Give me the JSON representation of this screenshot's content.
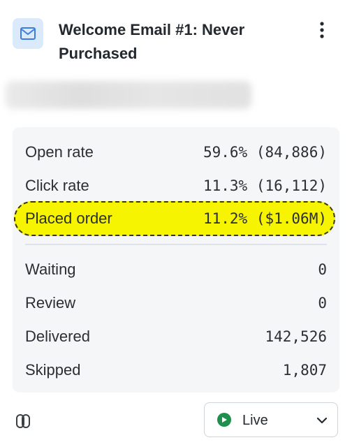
{
  "header": {
    "icon": "mail-icon",
    "title": "Welcome Email #1: Never Purchased",
    "menu_icon": "kebab-menu-icon"
  },
  "stats": {
    "metrics": [
      {
        "label": "Open rate",
        "value": "59.6% (84,886)"
      },
      {
        "label": "Click rate",
        "value": "11.3% (16,112)"
      },
      {
        "label": "Placed order",
        "value": "11.2% ($1.06M)"
      }
    ],
    "counts": [
      {
        "label": "Waiting",
        "value": "0"
      },
      {
        "label": "Review",
        "value": "0"
      },
      {
        "label": "Delivered",
        "value": "142,526"
      },
      {
        "label": "Skipped",
        "value": "1,807"
      }
    ]
  },
  "footer": {
    "link_icon": "link-icon",
    "status": {
      "label": "Live",
      "icon": "play-circle-icon",
      "dropdown_icon": "chevron-down-icon"
    }
  },
  "colors": {
    "highlight": "#f6f400",
    "live_green": "#1f8f4e",
    "icon_bg": "#dbeafb",
    "icon_blue": "#3b7ddd",
    "card_bg": "#f4f6f8"
  }
}
